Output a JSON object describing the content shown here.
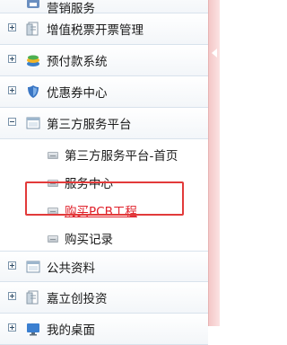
{
  "menu": {
    "top_partial": {
      "label": "营销服务",
      "icon": "store-icon"
    },
    "items": [
      {
        "label": "增值税票开票管理",
        "icon": "invoice-icon",
        "expanded": false
      },
      {
        "label": "预付款系统",
        "icon": "coins-icon",
        "expanded": false
      },
      {
        "label": "优惠券中心",
        "icon": "shield-icon",
        "expanded": false
      },
      {
        "label": "第三方服务平台",
        "icon": "window-icon",
        "expanded": true,
        "children": [
          {
            "label": "第三方服务平台-首页"
          },
          {
            "label": "服务中心"
          },
          {
            "label": "购买PCB工程",
            "active": true
          },
          {
            "label": "购买记录"
          }
        ]
      },
      {
        "label": "公共资料",
        "icon": "window-icon",
        "expanded": false
      },
      {
        "label": "嘉立创投资",
        "icon": "document-icon",
        "expanded": false
      },
      {
        "label": "我的桌面",
        "icon": "desktop-icon",
        "expanded": false
      }
    ]
  },
  "colors": {
    "active_link": "#e0202a",
    "highlight_border": "#e23a3a",
    "side_bar": "#f4c7c7"
  }
}
